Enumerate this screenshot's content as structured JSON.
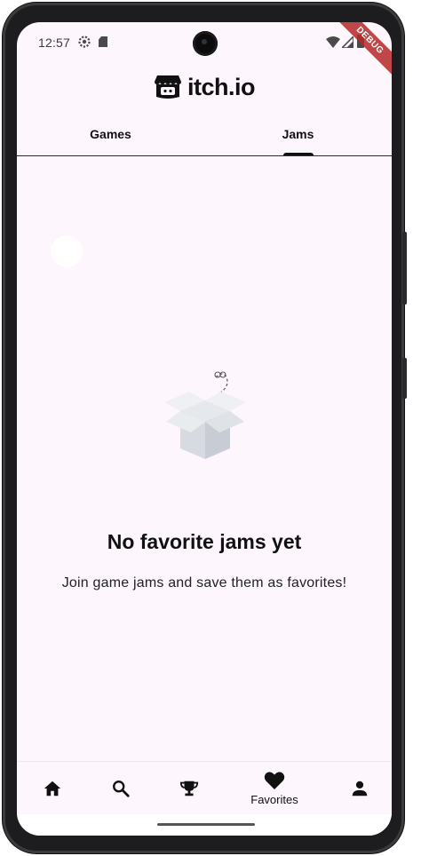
{
  "status_bar": {
    "time": "12:57",
    "debug_label": "DEBUG"
  },
  "app_bar": {
    "logo_text": "itch.io"
  },
  "tabs": [
    {
      "label": "Games",
      "selected": false
    },
    {
      "label": "Jams",
      "selected": true
    }
  ],
  "empty_state": {
    "title": "No favorite jams yet",
    "subtitle": "Join game jams and save them as favorites!",
    "illustration": "open-box-icon"
  },
  "bottom_nav": {
    "items": [
      {
        "icon": "home-icon",
        "label": ""
      },
      {
        "icon": "search-icon",
        "label": ""
      },
      {
        "icon": "trophy-icon",
        "label": ""
      },
      {
        "icon": "heart-icon",
        "label": "Favorites",
        "selected": true
      },
      {
        "icon": "person-icon",
        "label": ""
      }
    ]
  },
  "colors": {
    "background": "#fdf6fd",
    "text": "#111111",
    "frame": "#1d1d1f"
  }
}
